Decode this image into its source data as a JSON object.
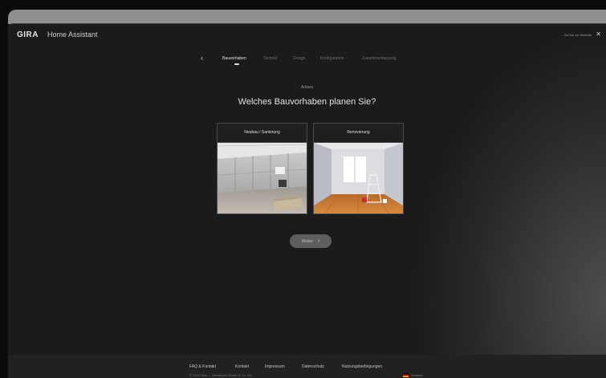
{
  "window": {
    "chrome_color": "#8f8f8f"
  },
  "appbar": {
    "logo": "GIRA",
    "title": "Home Assistant",
    "back_to_website": "Zurück zur Website",
    "close_icon": "close-icon"
  },
  "stepper": {
    "back_icon": "chevron-left-icon",
    "steps": [
      {
        "label": "Bauvorhaben",
        "active": true
      },
      {
        "label": "Technik",
        "active": false
      },
      {
        "label": "Design",
        "active": false
      },
      {
        "label": "Konfiguration",
        "active": false
      },
      {
        "label": "Zusammenfassung",
        "active": false
      }
    ]
  },
  "main": {
    "eyebrow": "Anlass",
    "question": "Welches Bauvorhaben planen Sie?",
    "options": [
      {
        "label": "Neubau / Sanierung",
        "image": "unfinished-room-drywall"
      },
      {
        "label": "Renovierung",
        "image": "empty-room-wooden-floor"
      }
    ],
    "next_button": "Weiter",
    "next_icon": "chevron-right-icon"
  },
  "footer": {
    "links": [
      "FAQ & Kontakt",
      "Kontakt",
      "Impressum",
      "Datenschutz",
      "Nutzungsbedingungen"
    ],
    "copyright": "© 2022 Gira — Giersiepen GmbH & Co. KG",
    "language": "Deutsch",
    "language_icon": "german-flag-icon"
  },
  "colors": {
    "background": "#1b1b1b",
    "button": "#5e5e5e",
    "card_border": "#4a4a4a"
  }
}
